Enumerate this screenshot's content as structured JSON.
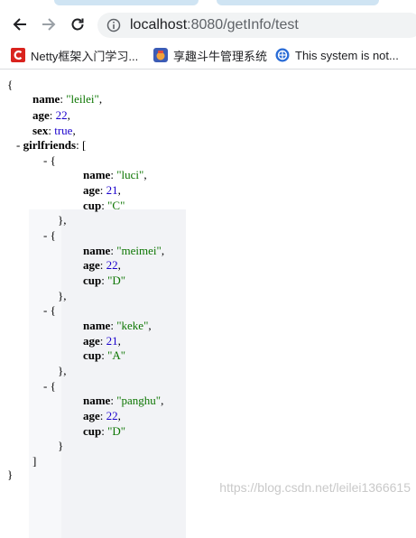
{
  "browser": {
    "url_host": "localhost",
    "url_rest": ":8080/getInfo/test",
    "bookmarks": [
      {
        "label": "Netty框架入门学习...",
        "icon": "c-logo-icon"
      },
      {
        "label": "享趣斗牛管理系统",
        "icon": "app-logo-icon"
      },
      {
        "label": "This system is not...",
        "icon": "firefox-globe-icon"
      }
    ]
  },
  "json_view": {
    "open_brace": "{",
    "close_brace": "}",
    "name_key": "name",
    "name_val": "\"leilei\"",
    "age_key": "age",
    "age_val": "22",
    "sex_key": "sex",
    "sex_val": "true",
    "gf_key": "girlfriends",
    "gf_open": "[",
    "gf_close": "]",
    "girlfriends": [
      {
        "name": "\"luci\"",
        "age": "21",
        "cup": "\"C\""
      },
      {
        "name": "\"meimei\"",
        "age": "22",
        "cup": "\"D\""
      },
      {
        "name": "\"keke\"",
        "age": "21",
        "cup": "\"A\""
      },
      {
        "name": "\"panghu\"",
        "age": "22",
        "cup": "\"D\""
      }
    ],
    "cup_key": "cup"
  },
  "watermark": "https://blog.csdn.net/leilei1366615",
  "colors": {
    "string": "#0b7500",
    "number": "#1a01cc",
    "omnibox": "#f1f3f4"
  }
}
